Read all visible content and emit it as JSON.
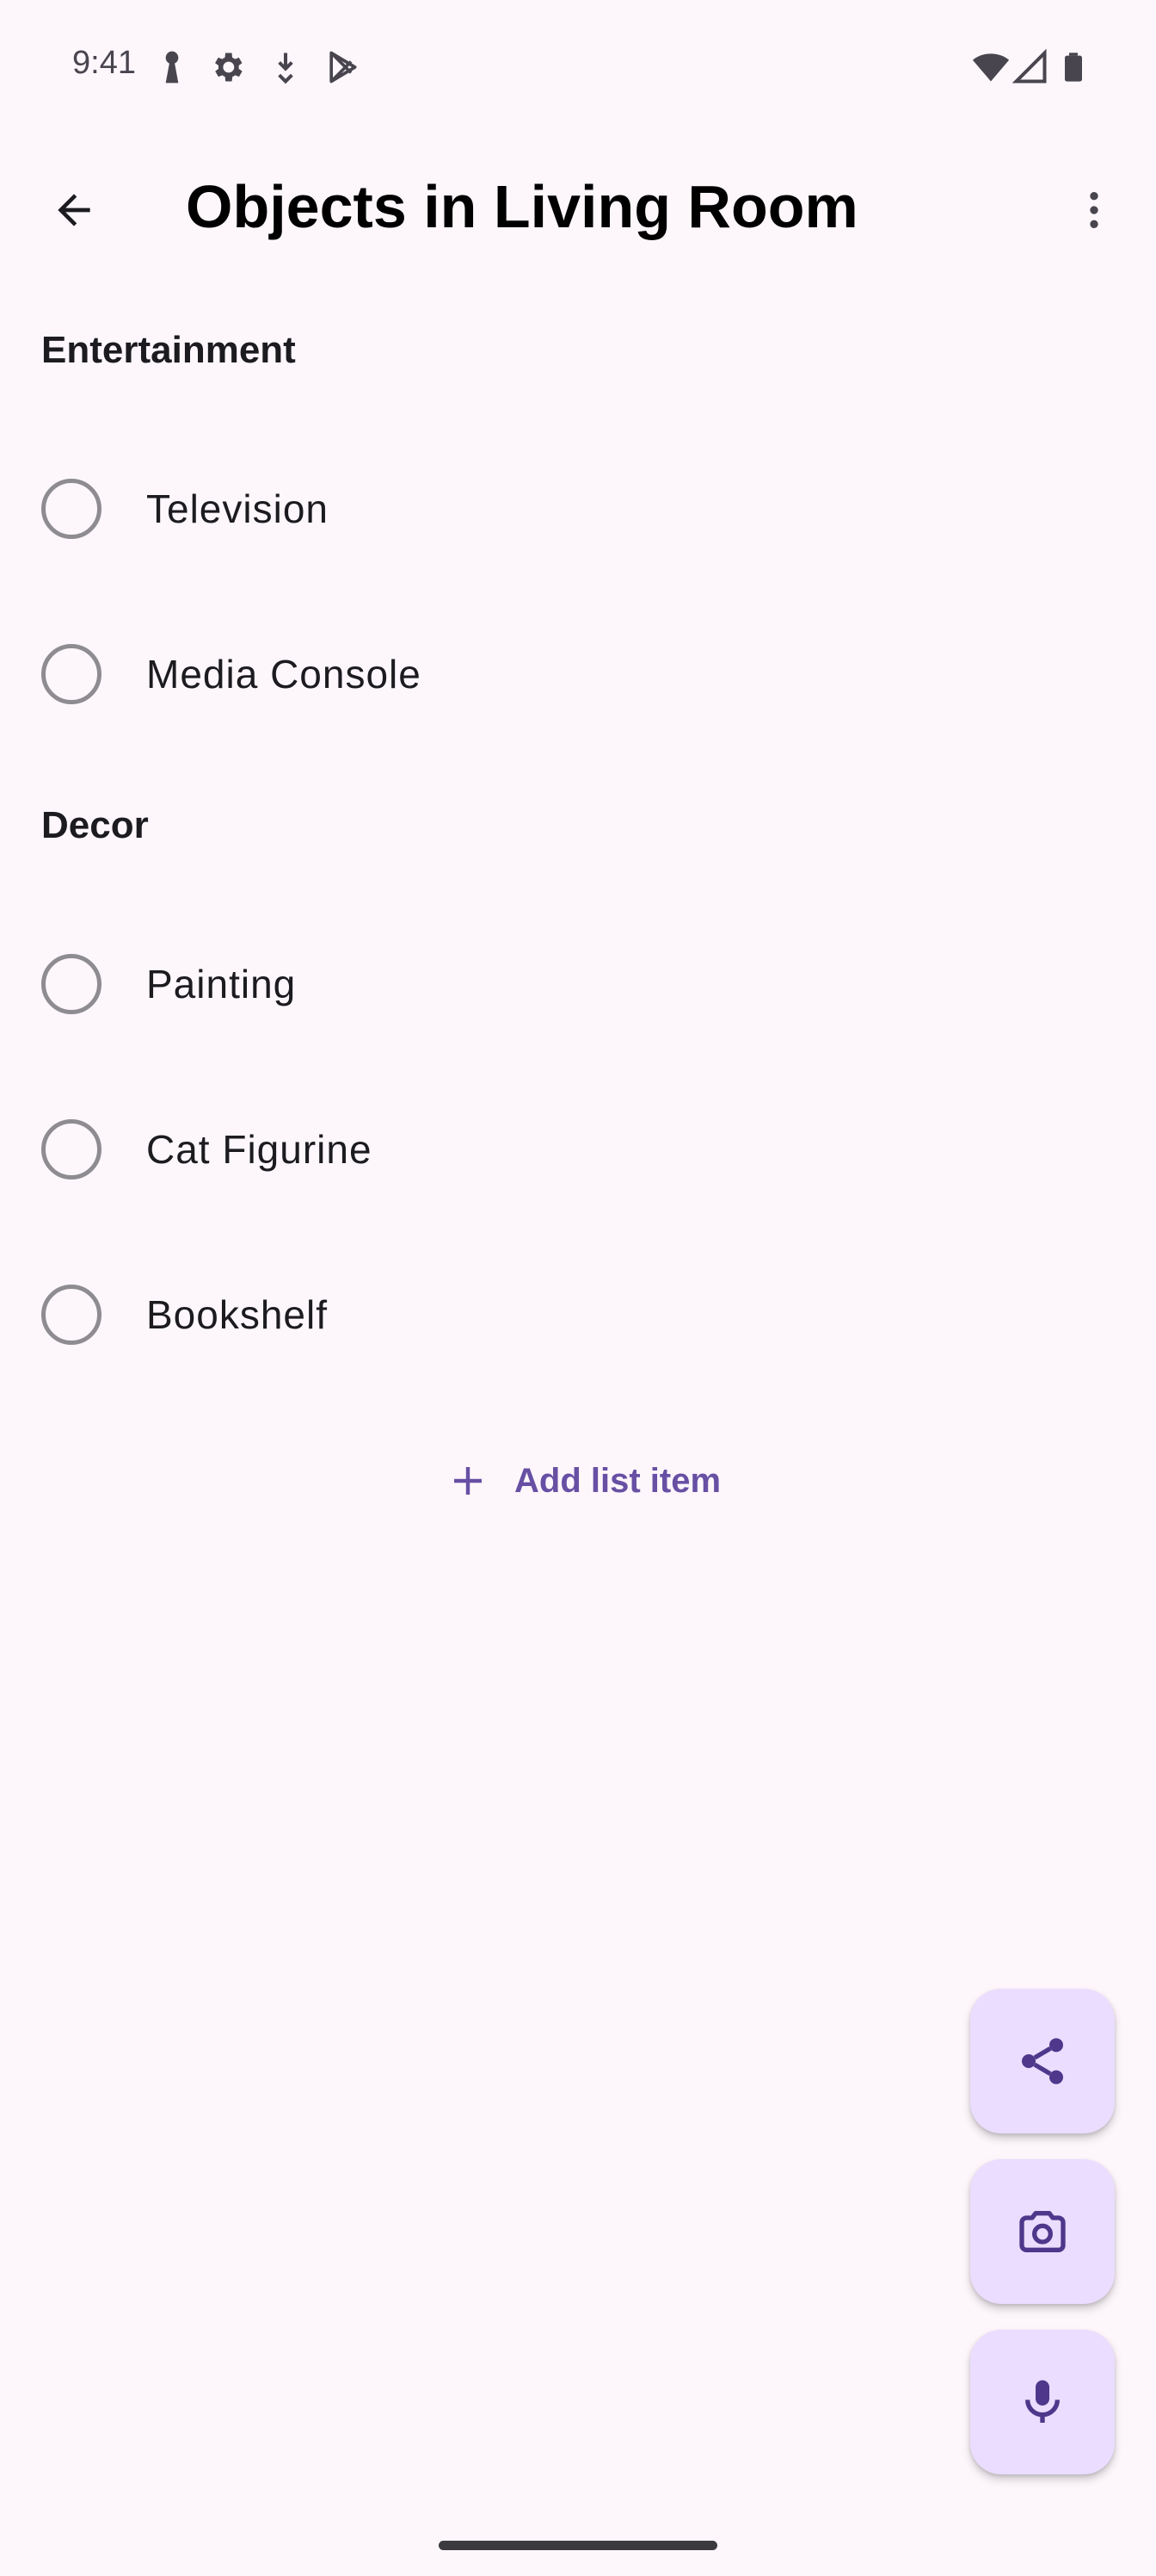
{
  "status_bar": {
    "time": "9:41",
    "left_icons": [
      "keyhole-icon",
      "gear-icon",
      "download-icon",
      "play-store-icon"
    ],
    "right_icons": [
      "wifi-icon",
      "signal-icon",
      "battery-icon"
    ]
  },
  "app_bar": {
    "title": "Objects in Living Room",
    "back_icon": "arrow-back-icon",
    "more_icon": "more-vert-icon"
  },
  "sections": [
    {
      "header": "Entertainment",
      "items": [
        "Television",
        "Media Console"
      ]
    },
    {
      "header": "Decor",
      "items": [
        "Painting",
        "Cat Figurine",
        "Bookshelf"
      ]
    }
  ],
  "add_item": {
    "label": "Add list item",
    "icon": "plus-icon"
  },
  "fabs": [
    {
      "name": "share",
      "icon": "share-icon"
    },
    {
      "name": "camera",
      "icon": "camera-icon"
    },
    {
      "name": "mic",
      "icon": "mic-icon"
    }
  ],
  "colors": {
    "background": "#FDF7FC",
    "accent": "#6750A4",
    "fab_background": "#EADDFF",
    "fab_icon": "#4F378B",
    "radio_outline": "#8E8C90"
  }
}
